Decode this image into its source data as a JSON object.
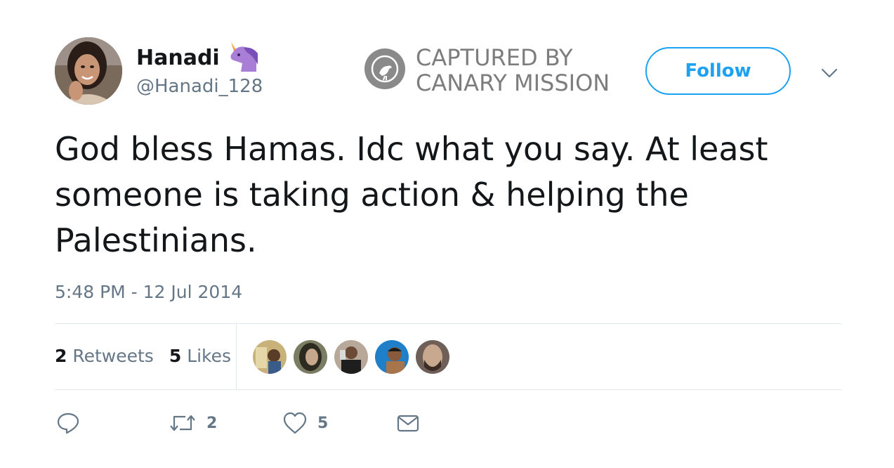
{
  "user": {
    "display_name": "Hanadi",
    "name_emoji": "unicorn-icon",
    "handle": "@Hanadi_128"
  },
  "watermark": {
    "line1": "CAPTURED BY",
    "line2": "CANARY MISSION",
    "icon": "canary-bird-icon"
  },
  "follow_label": "Follow",
  "tweet": {
    "text": "God bless Hamas. Idc what you say. At least someone is taking action & helping the Palestinians.",
    "timestamp": "5:48 PM - 12 Jul 2014"
  },
  "stats": {
    "retweets_count": "2",
    "retweets_label": "Retweets",
    "likes_count": "5",
    "likes_label": "Likes"
  },
  "actions": {
    "reply_count": "",
    "retweet_count": "2",
    "like_count": "5"
  },
  "colors": {
    "accent": "#1da1f2",
    "muted": "#657786",
    "text": "#14171a",
    "divider": "#e1e8ed"
  }
}
